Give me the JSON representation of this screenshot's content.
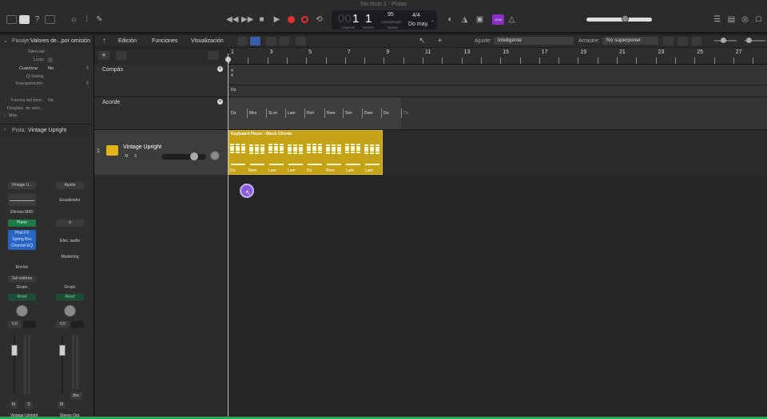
{
  "window": {
    "title": "Sin título 1 - Pistas"
  },
  "lcd": {
    "bar": "1",
    "beat": "1",
    "bar_label": "COMPÁS",
    "beat_label": "TIEMPO",
    "tempo": "95",
    "tempo_mode": "CONSERVAR",
    "tempo_label": "TEMPO",
    "signature": "4/4",
    "key": "Do may.",
    "sub_label": "1"
  },
  "toolbar": {
    "count_in": "1234",
    "edit_menu": "Edición",
    "functions_menu": "Funciones",
    "view_menu": "Visualización",
    "snap_label": "Ajuste:",
    "snap_value": "Inteligente",
    "drag_label": "Arrastre:",
    "drag_value": "No superponer"
  },
  "inspector": {
    "region_header": "Pasaje:",
    "region_name": "Valores de...por omisión",
    "rows": [
      {
        "label": "Silenciar:",
        "value": ""
      },
      {
        "label": "Loop:",
        "value": ""
      },
      {
        "label": "Cuantizar",
        "value": "No"
      },
      {
        "label": "Q-Swing:",
        "value": ""
      },
      {
        "label": "Transposición:",
        "value": ""
      },
      {
        "label": "Fuerza del tono:",
        "value": "No"
      },
      {
        "label": "Desplaz. de velo...",
        "value": ""
      }
    ],
    "more": "Más",
    "track_header": "Pista:",
    "track_name": "Vintage Upright",
    "strip1": {
      "setting": "Vintage U...",
      "midi_fx": "Efectos MIDI",
      "instrument": "Piano",
      "plugins": [
        "Phat FX",
        "Spring Box",
        "Channel EQ"
      ],
      "sends": "Envíos",
      "output": "Sal estéreo",
      "group": "Grupo",
      "automation": "Read",
      "volume": "0,0",
      "mute": "M",
      "solo": "S",
      "name": "Vintage Upright"
    },
    "strip2": {
      "setting": "Ajuste",
      "eq": "Ecualizador",
      "audio_fx": "Efec. audio",
      "mastering": "Mastering",
      "group": "Grupo",
      "automation": "Read",
      "volume": "0,0",
      "bounce": "Bnc",
      "mute": "M",
      "name": "Stereo Out"
    }
  },
  "global_tracks": {
    "signature": "Compás",
    "chord": "Acorde",
    "signature_value": "4\n4",
    "key_value": "Do"
  },
  "track": {
    "number": "1",
    "name": "Vintage Upright",
    "mute": "M",
    "solo": "S"
  },
  "ruler": {
    "marks": [
      "1",
      "3",
      "5",
      "7",
      "9",
      "11",
      "13",
      "15",
      "17",
      "19",
      "21",
      "23",
      "25",
      "27"
    ]
  },
  "chords": [
    "Do",
    "Mim",
    "Si♭m",
    "Lam",
    "Re#",
    "Rem",
    "Sim",
    "Dom",
    "Do",
    "Do"
  ],
  "region": {
    "title": "Keyboard Player - Block Chords",
    "chords": [
      "Do",
      "Rem",
      "Lam",
      "Lam",
      "Do",
      "Rem",
      "Lam",
      "Lam"
    ]
  }
}
